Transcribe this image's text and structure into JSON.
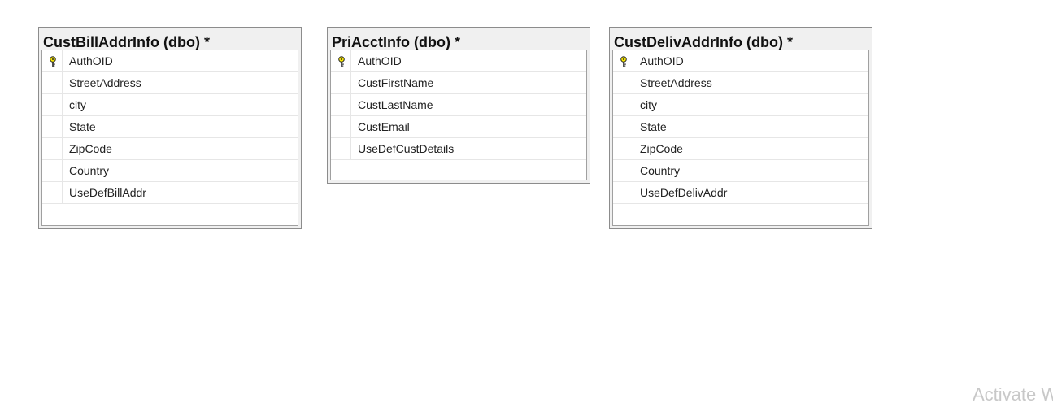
{
  "tables": [
    {
      "title": "CustBillAddrInfo (dbo) *",
      "columns": [
        {
          "name": "AuthOID",
          "key": true
        },
        {
          "name": "StreetAddress",
          "key": false
        },
        {
          "name": "city",
          "key": false
        },
        {
          "name": "State",
          "key": false
        },
        {
          "name": "ZipCode",
          "key": false
        },
        {
          "name": "Country",
          "key": false
        },
        {
          "name": "UseDefBillAddr",
          "key": false
        }
      ]
    },
    {
      "title": "PriAcctInfo (dbo) *",
      "columns": [
        {
          "name": "AuthOID",
          "key": true
        },
        {
          "name": "CustFirstName",
          "key": false
        },
        {
          "name": "CustLastName",
          "key": false
        },
        {
          "name": "CustEmail",
          "key": false
        },
        {
          "name": "UseDefCustDetails",
          "key": false
        }
      ]
    },
    {
      "title": "CustDelivAddrInfo (dbo) *",
      "columns": [
        {
          "name": "AuthOID",
          "key": true
        },
        {
          "name": "StreetAddress",
          "key": false
        },
        {
          "name": "city",
          "key": false
        },
        {
          "name": "State",
          "key": false
        },
        {
          "name": "ZipCode",
          "key": false
        },
        {
          "name": "Country",
          "key": false
        },
        {
          "name": "UseDefDelivAddr",
          "key": false
        }
      ]
    }
  ],
  "key_icon": "primary-key-icon",
  "key_icon_color": "#f5e400",
  "watermark": "Activate W"
}
